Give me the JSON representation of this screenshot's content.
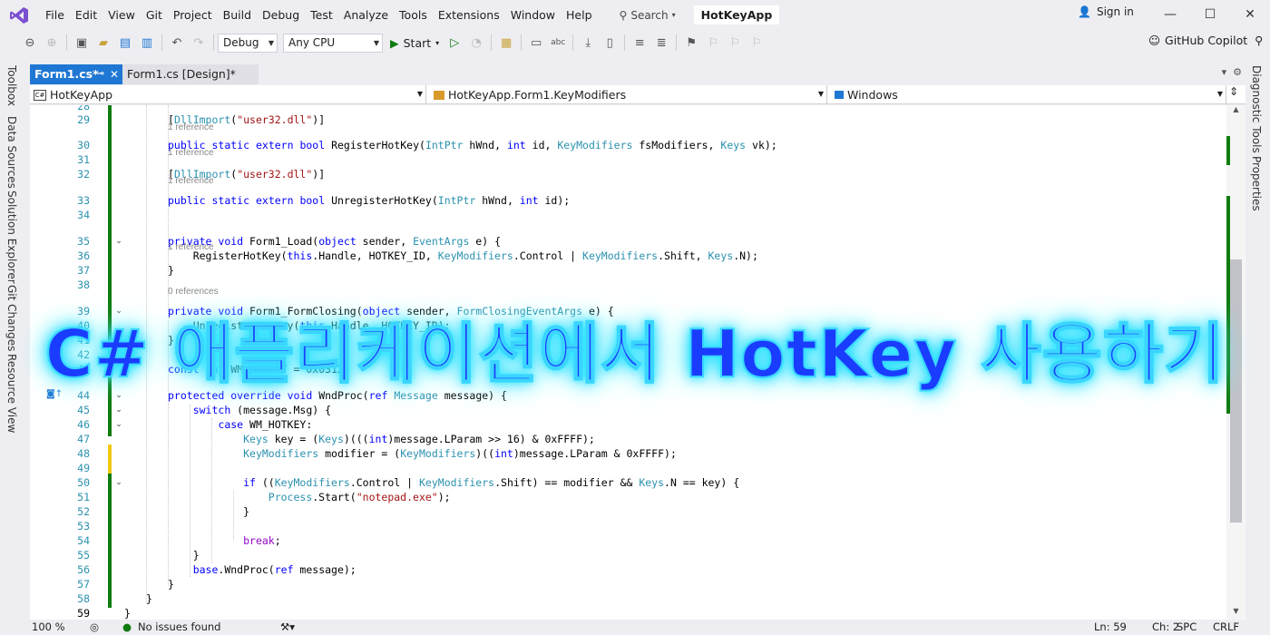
{
  "menubar": {
    "items": [
      "File",
      "Edit",
      "View",
      "Git",
      "Project",
      "Build",
      "Debug",
      "Test",
      "Analyze",
      "Tools",
      "Extensions",
      "Window",
      "Help"
    ],
    "search_label": "Search",
    "project_name": "HotKeyApp",
    "signin_label": "Sign in"
  },
  "toolbar": {
    "config": "Debug",
    "platform": "Any CPU",
    "start_label": "Start",
    "copilot_label": "GitHub Copilot"
  },
  "left_rail": [
    "Toolbox",
    "Data Sources",
    "Solution Explorer",
    "Git Changes",
    "Resource View"
  ],
  "right_rail": [
    "Diagnostic Tools",
    "Properties"
  ],
  "tabs": [
    {
      "label": "Form1.cs*",
      "active": true
    },
    {
      "label": "Form1.cs [Design]*",
      "active": false
    }
  ],
  "navbar": {
    "project": "HotKeyApp",
    "member": "HotKeyApp.Form1.KeyModifiers",
    "scope": "Windows"
  },
  "editor": {
    "current_line": "59",
    "lines": [
      {
        "n": "28",
        "t": ""
      },
      {
        "n": "29",
        "t": "[DllImport(\"user32.dll\")]"
      },
      {
        "n": "30",
        "t": "public static extern bool RegisterHotKey(IntPtr hWnd, int id, KeyModifiers fsModifiers, Keys vk);"
      },
      {
        "n": "31",
        "t": ""
      },
      {
        "n": "32",
        "t": "[DllImport(\"user32.dll\")]"
      },
      {
        "n": "33",
        "t": "public static extern bool UnregisterHotKey(IntPtr hWnd, int id);"
      },
      {
        "n": "34",
        "t": ""
      },
      {
        "n": "35",
        "t": "private void Form1_Load(object sender, EventArgs e) {"
      },
      {
        "n": "36",
        "t": "    RegisterHotKey(this.Handle, HOTKEY_ID, KeyModifiers.Control | KeyModifiers.Shift, Keys.N);"
      },
      {
        "n": "37",
        "t": "}"
      },
      {
        "n": "38",
        "t": ""
      },
      {
        "n": "39",
        "t": "private void Form1_FormClosing(object sender, FormClosingEventArgs e) {"
      },
      {
        "n": "40",
        "t": "    UnregisterHotKey(this.Handle, HOTKEY_ID);"
      },
      {
        "n": "41",
        "t": "}"
      },
      {
        "n": "42",
        "t": ""
      },
      {
        "n": "43",
        "t": "const int WM_HOTKEY = 0x0312;"
      },
      {
        "n": "44",
        "t": "protected override void WndProc(ref Message message) {"
      },
      {
        "n": "45",
        "t": "    switch (message.Msg) {"
      },
      {
        "n": "46",
        "t": "        case WM_HOTKEY:"
      },
      {
        "n": "47",
        "t": "            Keys key = (Keys)(((int)message.LParam >> 16) & 0xFFFF);"
      },
      {
        "n": "48",
        "t": "            KeyModifiers modifier = (KeyModifiers)((int)message.LParam & 0xFFFF);"
      },
      {
        "n": "49",
        "t": ""
      },
      {
        "n": "50",
        "t": "            if ((KeyModifiers.Control | KeyModifiers.Shift) == modifier && Keys.N == key) {"
      },
      {
        "n": "51",
        "t": "                Process.Start(\"notepad.exe\");"
      },
      {
        "n": "52",
        "t": "            }"
      },
      {
        "n": "53",
        "t": ""
      },
      {
        "n": "54",
        "t": "            break;"
      },
      {
        "n": "55",
        "t": "    }"
      },
      {
        "n": "56",
        "t": "    base.WndProc(ref message);"
      },
      {
        "n": "57",
        "t": "}"
      },
      {
        "n": "58",
        "t": "}"
      },
      {
        "n": "59",
        "t": "}"
      }
    ],
    "refs": {
      "r29": "1 reference",
      "r32": "1 reference",
      "r35": "1 reference",
      "r39": "1 reference",
      "r43": "0 references"
    }
  },
  "statusbar": {
    "zoom": "100 %",
    "issues": "No issues found",
    "ln": "Ln: 59",
    "ch": "Ch: 2",
    "spc": "SPC",
    "crlf": "CRLF"
  },
  "overlay": {
    "title": "C# 애플리케이션에서 HotKey 사용하기"
  },
  "colors": {
    "accent": "#1e77d3",
    "change_bar": "#107c10",
    "overlay_text": "#1a3cff",
    "overlay_glow": "#2ff3ff"
  }
}
